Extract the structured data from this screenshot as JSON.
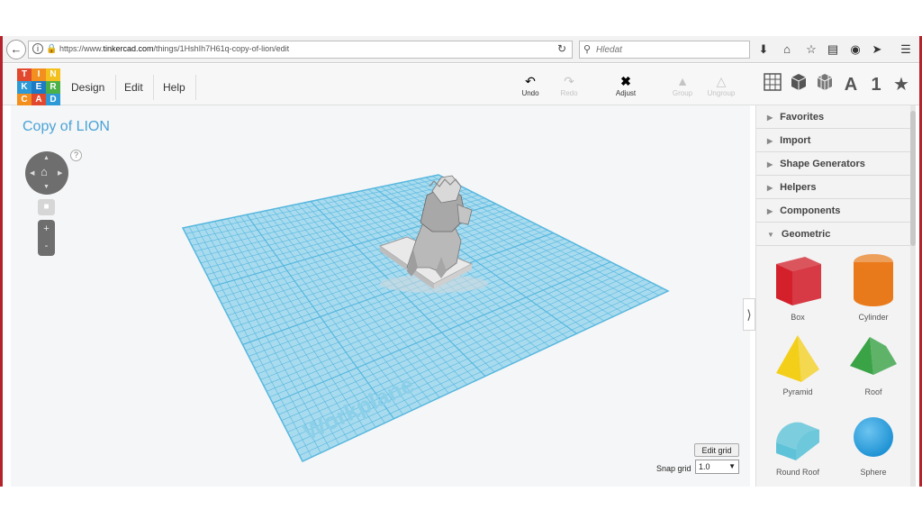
{
  "browser": {
    "url_prefix": "https://www.",
    "url_domain": "tinkercad.com",
    "url_path": "/things/1HshIh7H61q-copy-of-lion/edit",
    "search_placeholder": "Hledat",
    "toolbar_icons": [
      "download-icon",
      "home-icon",
      "star-icon",
      "reading-list-icon",
      "pocket-icon",
      "send-icon",
      "hamburger-menu-icon"
    ]
  },
  "logo": {
    "letters": [
      "T",
      "I",
      "N",
      "K",
      "E",
      "R",
      "C",
      "A",
      "D"
    ],
    "colors": [
      "#e2482e",
      "#f28f1e",
      "#f3c01d",
      "#2d9ad6",
      "#1c7bc4",
      "#4cb049",
      "#f28f1e",
      "#e2482e",
      "#2d9ad6"
    ]
  },
  "menu": {
    "design": "Design",
    "edit": "Edit",
    "help": "Help"
  },
  "tools": {
    "undo": "Undo",
    "redo": "Redo",
    "adjust": "Adjust",
    "group": "Group",
    "ungroup": "Ungroup"
  },
  "views": {
    "text_label": "A",
    "number_label": "1"
  },
  "workspace": {
    "title": "Copy of LION",
    "help": "?",
    "workplane_label": "Workplane",
    "edit_grid": "Edit grid",
    "snap_grid_label": "Snap grid",
    "snap_grid_value": "1.0"
  },
  "sidebar": {
    "categories": [
      "Favorites",
      "Import",
      "Shape Generators",
      "Helpers",
      "Components",
      "Geometric"
    ],
    "shapes": [
      {
        "name": "Box",
        "color": "#d3202b"
      },
      {
        "name": "Cylinder",
        "color": "#e97a1b"
      },
      {
        "name": "Pyramid",
        "color": "#f4cf19"
      },
      {
        "name": "Roof",
        "color": "#3aa346"
      },
      {
        "name": "Round Roof",
        "color": "#5ec3d8"
      },
      {
        "name": "Sphere",
        "color": "#1a8fd2"
      }
    ]
  },
  "colors": {
    "accent": "#4aa3d6",
    "grid_fill": "#a9dbef",
    "grid_line": "#56b7de"
  }
}
